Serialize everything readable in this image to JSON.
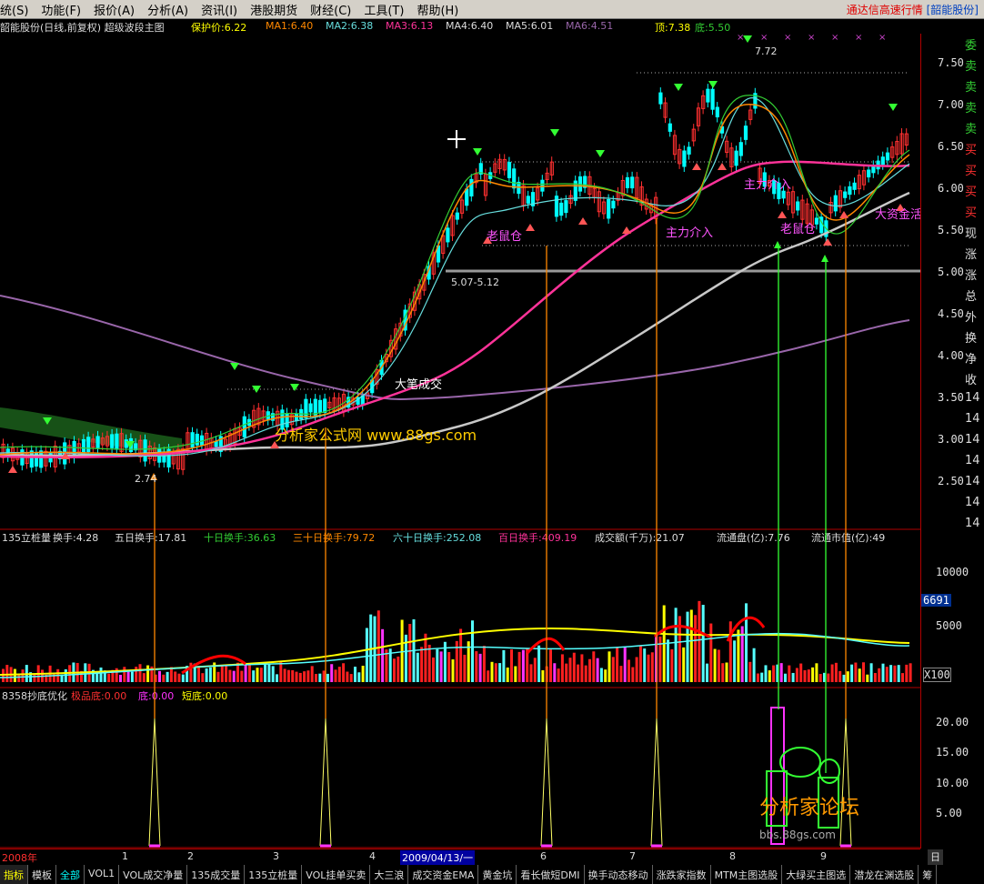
{
  "menu": {
    "items": [
      "统(S)",
      "功能(F)",
      "报价(A)",
      "分析(A)",
      "资讯(I)",
      "港股期货",
      "财经(C)",
      "工具(T)",
      "帮助(H)"
    ],
    "right_text": "通达信高速行情",
    "right_stock": "[韶能股份]"
  },
  "main_panel": {
    "title": "韶能股份(日线,前复权) 超级波段主图",
    "protect_price": "保护价:6.22",
    "ma1": "MA1:6.40",
    "ma2": "MA2:6.38",
    "ma3": "MA3:6.13",
    "ma4": "MA4:6.40",
    "ma5": "MA5:6.01",
    "ma6": "MA6:4.51",
    "top": "顶:7.38",
    "bottom": "底:5.50",
    "annotations": {
      "peak": "7.72",
      "low": "2.74",
      "range": "5.07-5.12",
      "big_trade": "大笔成交",
      "mouse_pos_1": "老鼠仓",
      "mouse_pos_2": "老鼠仓",
      "main_force_1": "主力介入",
      "main_force_2": "主力介入",
      "big_funds": "大资金活",
      "watermark": "分析家公式网 www.88gs.com"
    },
    "price_labels": [
      "7.50",
      "7.00",
      "6.50",
      "6.00",
      "5.50",
      "5.00",
      "4.50",
      "4.00",
      "3.50",
      "3.00",
      "2.50"
    ],
    "side_tags": [
      "委",
      "卖",
      "卖",
      "卖",
      "卖",
      "买",
      "买",
      "买",
      "买",
      "现",
      "涨",
      "涨",
      "总",
      "外",
      "换",
      "净",
      "收",
      "14",
      "14",
      "14",
      "14",
      "14",
      "14",
      "14"
    ]
  },
  "vol_panel": {
    "title": "135立桩量",
    "turnover": "换手:4.28",
    "t5": "五日换手:17.81",
    "t10": "十日换手:36.63",
    "t30": "三十日换手:79.72",
    "t60": "六十日换手:252.08",
    "t100": "百日换手:409.19",
    "amount": "成交额(千万):21.07",
    "float_shares": "流通盘(亿):7.76",
    "float_value": "流通市值(亿):49",
    "labels": [
      "10000",
      "5000"
    ],
    "current": "6691",
    "unit": "X100"
  },
  "ind_panel": {
    "title": "8358抄底优化",
    "extreme_low": "极品底:0.00",
    "low": "底:0.00",
    "short_low": "短底:0.00",
    "labels": [
      "20.00",
      "15.00",
      "10.00",
      "5.00"
    ],
    "watermark_title": "分析家论坛",
    "watermark_url": "bbs.88gs.com"
  },
  "datebar": {
    "year": "2008年",
    "months": [
      "1",
      "2",
      "3",
      "4",
      "6",
      "7",
      "8",
      "9"
    ],
    "cursor_date": "2009/04/13/一",
    "period": "日线"
  },
  "tabs": [
    "指标",
    "模板",
    "全部",
    "VOL1",
    "VOL成交净量",
    "135成交量",
    "135立桩量",
    "VOL挂单买卖",
    "大三浪",
    "成交资金EMA",
    "黄金坑",
    "看长做短DMI",
    "换手动态移动",
    "涨跌家指数",
    "MTM主图选股",
    "大绿买主图选",
    "潜龙在渊选股",
    "筹"
  ],
  "colors": {
    "up": "#ff3030",
    "down": "#00ffff",
    "ma_pink": "#ff3399",
    "ma_white": "#c8c8c8",
    "ma_purple": "#9966aa",
    "ma_orange": "#ff8800",
    "ma_green": "#33cc33",
    "ma_cyan": "#66dddd",
    "grid": "#b00000"
  }
}
